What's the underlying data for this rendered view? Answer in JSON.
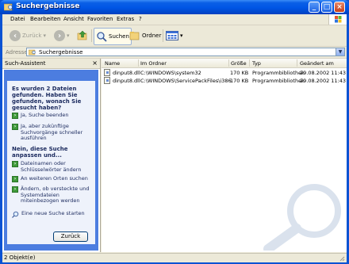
{
  "window": {
    "title": "Suchergebnisse"
  },
  "menu": [
    "Datei",
    "Bearbeiten",
    "Ansicht",
    "Favoriten",
    "Extras",
    "?"
  ],
  "toolbar": {
    "back_label": "Zurück",
    "search_label": "Suchen",
    "folders_label": "Ordner"
  },
  "address": {
    "label": "Adresse",
    "value": "Suchergebnisse"
  },
  "assistant": {
    "title": "Such-Assistent",
    "question": "Es wurden 2 Dateien gefunden. Haben Sie gefunden, wonach Sie gesucht haben?",
    "options_yes": [
      "Ja, Suche beenden",
      "Ja, aber zukünftige Suchvorgänge schneller ausführen"
    ],
    "refine_heading": "Nein, diese Suche anpassen und...",
    "options_refine": [
      "Dateinamen oder Schlüsselwörter ändern",
      "An weiteren Orten suchen",
      "Ändern, ob versteckte und Systemdateien miteinbezogen werden"
    ],
    "new_search": "Eine neue Suche starten",
    "back_button": "Zurück"
  },
  "columns": [
    "Name",
    "Im Ordner",
    "Größe",
    "Typ",
    "Geändert am"
  ],
  "files": [
    {
      "name": "dinput8.dll",
      "folder": "C:\\WINDOWS\\system32",
      "size": "170 KB",
      "type": "Programmbibliothek",
      "modified": "29.08.2002 11:43"
    },
    {
      "name": "dinput8.dll",
      "folder": "C:\\WINDOWS\\ServicePackFiles\\i386",
      "size": "170 KB",
      "type": "Programmbibliothek",
      "modified": "29.08.2002 11:43"
    }
  ],
  "status": {
    "text": "2 Objekt(e)"
  },
  "colors": {
    "titlebar": "#0055e5",
    "assistant_border": "#4c7de0",
    "client": "#ece9d8"
  }
}
